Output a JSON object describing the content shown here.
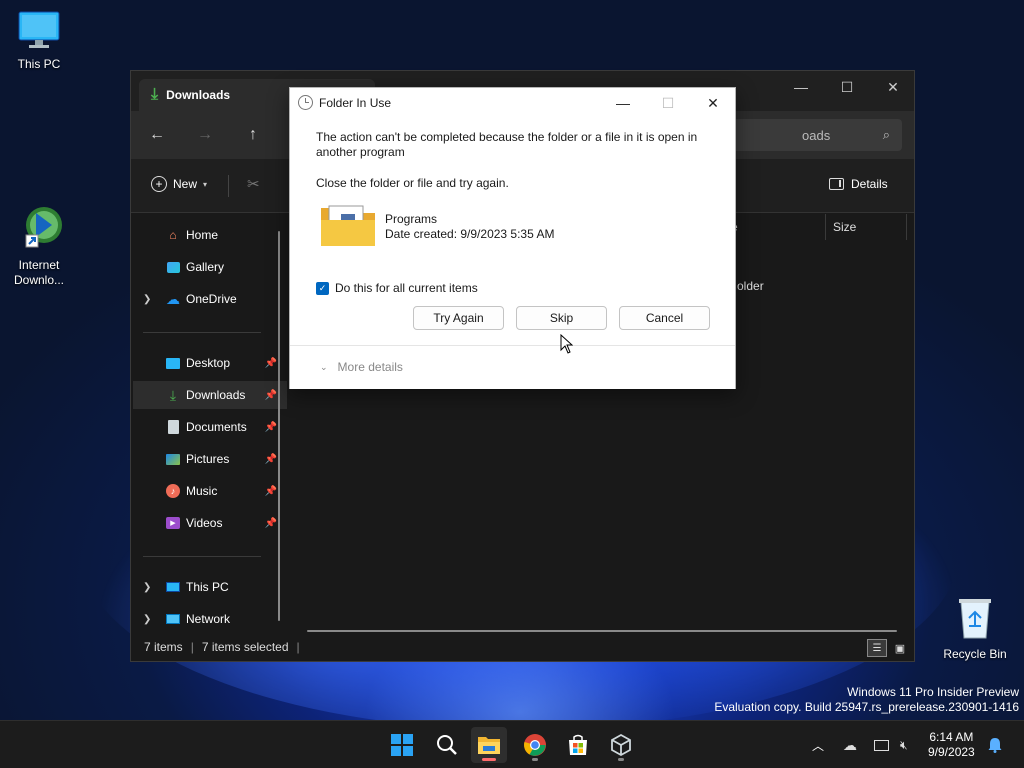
{
  "desktop": {
    "icons": [
      {
        "label": "This PC"
      },
      {
        "label": "Internet Downlo..."
      },
      {
        "label": "Recycle Bin"
      }
    ],
    "watermark_line1": "Windows 11 Pro Insider Preview",
    "watermark_line2": "Evaluation copy. Build 25947.rs_prerelease.230901-1416"
  },
  "explorer": {
    "tab_title": "Downloads",
    "search_text": "oads",
    "toolbar": {
      "new_label": "New",
      "details_label": "Details"
    },
    "column_size": "Size",
    "partial_name_column": "e",
    "partial_row_text": "older",
    "sidebar": {
      "home": "Home",
      "gallery": "Gallery",
      "onedrive": "OneDrive",
      "desktop": "Desktop",
      "downloads": "Downloads",
      "documents": "Documents",
      "pictures": "Pictures",
      "music": "Music",
      "videos": "Videos",
      "thispc": "This PC",
      "network": "Network"
    },
    "status": {
      "items": "7 items",
      "selected": "7 items selected"
    }
  },
  "dialog": {
    "title": "Folder In Use",
    "message": "The action can't be completed because the folder or a file in it is open in another program",
    "instruction": "Close the folder or file and try again.",
    "item_name": "Programs",
    "item_date": "Date created: 9/9/2023 5:35 AM",
    "checkbox_label": "Do this for all current items",
    "checkbox_checked": true,
    "buttons": {
      "try_again": "Try Again",
      "skip": "Skip",
      "cancel": "Cancel"
    },
    "more_details": "More details"
  },
  "taskbar": {
    "time": "6:14 AM",
    "date": "9/9/2023"
  },
  "colors": {
    "accent": "#0067c0",
    "taskbar_indicator": "#ff6b6b"
  }
}
